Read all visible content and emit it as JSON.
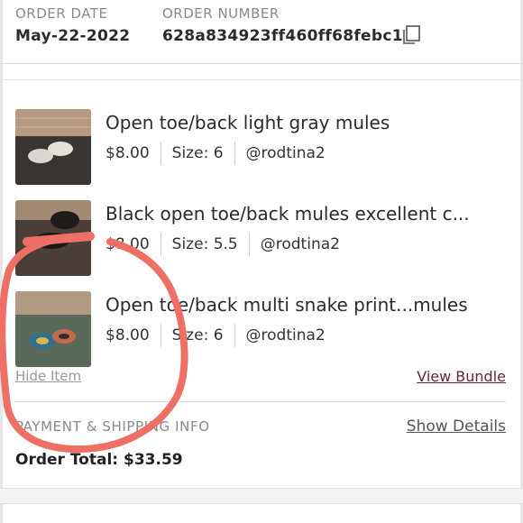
{
  "order": {
    "date_label": "ORDER DATE",
    "date_value": "May-22-2022",
    "number_label": "ORDER NUMBER",
    "number_value": "628a834923ff460ff68febc1"
  },
  "items": [
    {
      "title": "Open toe/back light gray mules",
      "price": "$8.00",
      "size": "Size: 6",
      "seller": "@rodtina2"
    },
    {
      "title": "Black open toe/back mules excellent c...",
      "price": "$8.00",
      "size": "Size: 5.5",
      "seller": "@rodtina2"
    },
    {
      "title": "Open toe/back multi snake print...mules",
      "price": "$8.00",
      "size": "Size: 6",
      "seller": "@rodtina2"
    }
  ],
  "links": {
    "hide_item": "Hide Item",
    "view_bundle": "View Bundle"
  },
  "payment": {
    "label": "PAYMENT & SHIPPING INFO",
    "show_details": "Show Details",
    "order_total": "Order Total: $33.59"
  },
  "colors": {
    "annotation_stroke": "#ee6f64",
    "view_bundle": "#6a1f3a"
  }
}
